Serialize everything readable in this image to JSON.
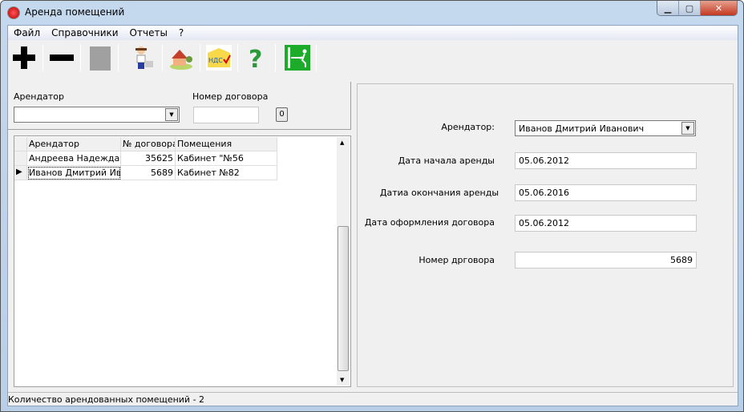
{
  "window": {
    "title": "Аренда помещений"
  },
  "menu": [
    "Файл",
    "Справочники",
    "Отчеты",
    "?"
  ],
  "toolbar": [
    {
      "icon": "plus-icon"
    },
    {
      "icon": "minus-icon"
    },
    {
      "icon": "disabled-icon"
    },
    {
      "icon": "tenant-person-icon"
    },
    {
      "icon": "house-icon"
    },
    {
      "icon": "tax-box-icon"
    },
    {
      "icon": "help-question-icon"
    },
    {
      "icon": "exit-door-icon"
    }
  ],
  "filter": {
    "tenant_label": "Арендатор",
    "tenant_value": "",
    "contract_label": "Номер договора",
    "contract_value": "",
    "button_label": "0"
  },
  "grid": {
    "columns": [
      "Арендатор",
      "№ договора",
      "Помещения"
    ],
    "rows": [
      {
        "tenant": "Андреева Надежда Де",
        "contract": "35625",
        "room": "Кабинет \"№56"
      },
      {
        "tenant": "Иванов Дмитрий Иван",
        "contract": "5689",
        "room": "Кабинет №82"
      }
    ],
    "selected_row": 1
  },
  "details": {
    "tenant_label": "Арендатор:",
    "tenant_value": "Иванов Дмитрий Иванович",
    "start_label": "Дата начала аренды",
    "start_value": "05.06.2012",
    "end_label": "Датиа окончания аренды",
    "end_value": "05.06.2016",
    "signed_label": "Дата оформления договора",
    "signed_value": "05.06.2012",
    "number_label": "Номер дрговора",
    "number_value": "5689"
  },
  "status": "Количество арендованных помещений - 2"
}
